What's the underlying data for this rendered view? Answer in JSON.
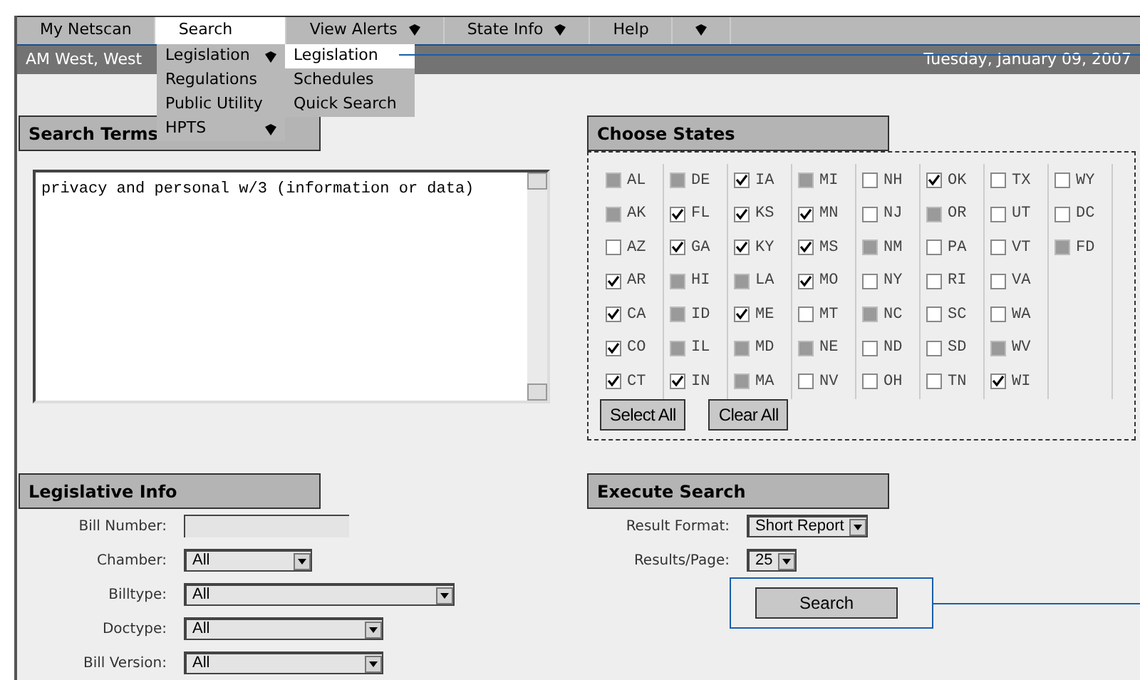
{
  "menu_bar": {
    "items": [
      {
        "label": "My Netscan",
        "selected": false,
        "arrow": false
      },
      {
        "label": "Search",
        "selected": true,
        "arrow": false
      },
      {
        "label": "View Alerts",
        "selected": false,
        "arrow": true
      },
      {
        "label": "State Info",
        "selected": false,
        "arrow": true
      },
      {
        "label": "Help",
        "selected": false,
        "arrow": false
      },
      {
        "selected": false,
        "arrow": true
      }
    ]
  },
  "search_menu": {
    "items": [
      {
        "label": "Legislation",
        "arrow": true,
        "selected": false
      },
      {
        "label": "Regulations",
        "arrow": false,
        "selected": false
      },
      {
        "label": "Public Utility",
        "arrow": false,
        "selected": false
      },
      {
        "label": "HPTS",
        "arrow": true,
        "selected": false
      }
    ]
  },
  "legislation_submenu": {
    "items": [
      {
        "label": "Legislation",
        "selected": true
      },
      {
        "label": "Schedules",
        "selected": false
      },
      {
        "label": "Quick Search",
        "selected": false
      }
    ]
  },
  "header": {
    "user": "AM West, West",
    "date": "Tuesday, January 09, 2007"
  },
  "search_terms": {
    "title": "Search Terms",
    "value": "privacy and personal w/3 (information or data)"
  },
  "choose_states": {
    "title": "Choose States",
    "columns": [
      [
        {
          "code": "AL",
          "checked": false,
          "disabled": true
        },
        {
          "code": "AK",
          "checked": false,
          "disabled": true
        },
        {
          "code": "AZ",
          "checked": false,
          "disabled": false
        },
        {
          "code": "AR",
          "checked": true,
          "disabled": false
        },
        {
          "code": "CA",
          "checked": true,
          "disabled": false
        },
        {
          "code": "CO",
          "checked": true,
          "disabled": false
        },
        {
          "code": "CT",
          "checked": true,
          "disabled": false
        }
      ],
      [
        {
          "code": "DE",
          "checked": false,
          "disabled": true
        },
        {
          "code": "FL",
          "checked": true,
          "disabled": false
        },
        {
          "code": "GA",
          "checked": true,
          "disabled": false
        },
        {
          "code": "HI",
          "checked": false,
          "disabled": true
        },
        {
          "code": "ID",
          "checked": false,
          "disabled": true
        },
        {
          "code": "IL",
          "checked": false,
          "disabled": true
        },
        {
          "code": "IN",
          "checked": true,
          "disabled": false
        }
      ],
      [
        {
          "code": "IA",
          "checked": true,
          "disabled": false
        },
        {
          "code": "KS",
          "checked": true,
          "disabled": false
        },
        {
          "code": "KY",
          "checked": true,
          "disabled": false
        },
        {
          "code": "LA",
          "checked": false,
          "disabled": true
        },
        {
          "code": "ME",
          "checked": true,
          "disabled": false
        },
        {
          "code": "MD",
          "checked": false,
          "disabled": true
        },
        {
          "code": "MA",
          "checked": false,
          "disabled": true
        }
      ],
      [
        {
          "code": "MI",
          "checked": false,
          "disabled": true
        },
        {
          "code": "MN",
          "checked": true,
          "disabled": false
        },
        {
          "code": "MS",
          "checked": true,
          "disabled": false
        },
        {
          "code": "MO",
          "checked": true,
          "disabled": false
        },
        {
          "code": "MT",
          "checked": false,
          "disabled": false
        },
        {
          "code": "NE",
          "checked": false,
          "disabled": true
        },
        {
          "code": "NV",
          "checked": false,
          "disabled": false
        }
      ],
      [
        {
          "code": "NH",
          "checked": false,
          "disabled": false
        },
        {
          "code": "NJ",
          "checked": false,
          "disabled": false
        },
        {
          "code": "NM",
          "checked": false,
          "disabled": true
        },
        {
          "code": "NY",
          "checked": false,
          "disabled": false
        },
        {
          "code": "NC",
          "checked": false,
          "disabled": true
        },
        {
          "code": "ND",
          "checked": false,
          "disabled": false
        },
        {
          "code": "OH",
          "checked": false,
          "disabled": false
        }
      ],
      [
        {
          "code": "OK",
          "checked": true,
          "disabled": false
        },
        {
          "code": "OR",
          "checked": false,
          "disabled": true
        },
        {
          "code": "PA",
          "checked": false,
          "disabled": false
        },
        {
          "code": "RI",
          "checked": false,
          "disabled": false
        },
        {
          "code": "SC",
          "checked": false,
          "disabled": false
        },
        {
          "code": "SD",
          "checked": false,
          "disabled": false
        },
        {
          "code": "TN",
          "checked": false,
          "disabled": false
        }
      ],
      [
        {
          "code": "TX",
          "checked": false,
          "disabled": false
        },
        {
          "code": "UT",
          "checked": false,
          "disabled": false
        },
        {
          "code": "VT",
          "checked": false,
          "disabled": false
        },
        {
          "code": "VA",
          "checked": false,
          "disabled": false
        },
        {
          "code": "WA",
          "checked": false,
          "disabled": false
        },
        {
          "code": "WV",
          "checked": false,
          "disabled": true
        },
        {
          "code": "WI",
          "checked": true,
          "disabled": false
        }
      ],
      [
        {
          "code": "WY",
          "checked": false,
          "disabled": false
        },
        {
          "code": "DC",
          "checked": false,
          "disabled": false
        },
        {
          "code": "FD",
          "checked": false,
          "disabled": true
        }
      ]
    ],
    "buttons": [
      "Select All",
      "Clear All"
    ]
  },
  "legislative_info": {
    "title": "Legislative Info",
    "fields": [
      {
        "label": "Bill Number:",
        "kind": "text"
      },
      {
        "label": "Chamber:",
        "kind": "select",
        "value": "All"
      },
      {
        "label": "Billtype:",
        "kind": "select",
        "value": "All"
      },
      {
        "label": "Doctype:",
        "kind": "select",
        "value": "All"
      },
      {
        "label": "Bill Version:",
        "kind": "select",
        "value": "All"
      }
    ]
  },
  "execute_search": {
    "title": "Execute Search",
    "fields": [
      {
        "label": "Result Format:",
        "kind": "select",
        "value": "Short Report"
      },
      {
        "label": "Results/Page:",
        "kind": "select",
        "value": "25"
      }
    ],
    "button": "Search"
  }
}
